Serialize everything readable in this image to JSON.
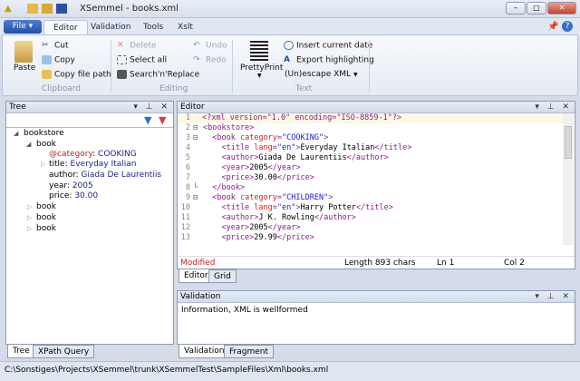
{
  "window": {
    "title": "XSemmel - books.xml",
    "min": "–",
    "max": "□",
    "close": "✕"
  },
  "ribbon": {
    "file": "File ▾",
    "tabs": [
      "Editor",
      "Validation",
      "Tools",
      "Xslt"
    ],
    "clipboard": {
      "paste": "Paste",
      "cut": "Cut",
      "copy": "Copy",
      "copy_path": "Copy file path",
      "group": "Clipboard"
    },
    "editing": {
      "delete": "Delete",
      "select_all": "Select all",
      "search": "Search'n'Replace",
      "undo": "Undo",
      "redo": "Redo",
      "group": "Editing"
    },
    "text": {
      "pretty": "PrettyPrint",
      "insert_date": "Insert current date",
      "export": "Export highlighting",
      "unescape": "(Un)escape XML",
      "group": "Text"
    }
  },
  "tree": {
    "title": "Tree",
    "controls": "▾ ⊥ ✕",
    "root": "bookstore",
    "book": "book",
    "cat_key": "@category",
    "cat_val": "COOKING",
    "title_key": "title:",
    "title_val": "Everyday Italian",
    "author_key": "author:",
    "author_val": "Giada De Laurentiis",
    "year_key": "year:",
    "year_val": "2005",
    "price_key": "price:",
    "price_val": "30.00",
    "tabs": [
      "Tree",
      "XPath Query"
    ]
  },
  "editor": {
    "title": "Editor",
    "controls": "▾ ⊥ ✕",
    "lines": [
      [
        [
          "t",
          "<?xml version=\"1.0\" encoding=\"ISO-8859-1\"?>"
        ]
      ],
      [
        [
          "t",
          "<bookstore>"
        ]
      ],
      [
        [
          "t",
          "  <book "
        ],
        [
          "a",
          "category"
        ],
        [
          "t",
          "="
        ],
        [
          "v",
          "\"COOKING\""
        ],
        [
          "t",
          ">"
        ]
      ],
      [
        [
          "t",
          "    <title "
        ],
        [
          "a",
          "lang"
        ],
        [
          "t",
          "="
        ],
        [
          "v",
          "\"en\""
        ],
        [
          "t",
          ">"
        ],
        [
          "x",
          "Everyday Italian"
        ],
        [
          "t",
          "</title>"
        ]
      ],
      [
        [
          "t",
          "    <author>"
        ],
        [
          "x",
          "Giada De Laurentiis"
        ],
        [
          "t",
          "</author>"
        ]
      ],
      [
        [
          "t",
          "    <year>"
        ],
        [
          "x",
          "2005"
        ],
        [
          "t",
          "</year>"
        ]
      ],
      [
        [
          "t",
          "    <price>"
        ],
        [
          "x",
          "30.00"
        ],
        [
          "t",
          "</price>"
        ]
      ],
      [
        [
          "t",
          "  </book>"
        ]
      ],
      [
        [
          "t",
          "  <book "
        ],
        [
          "a",
          "category"
        ],
        [
          "t",
          "="
        ],
        [
          "v",
          "\"CHILDREN\""
        ],
        [
          "t",
          ">"
        ]
      ],
      [
        [
          "t",
          "    <title "
        ],
        [
          "a",
          "lang"
        ],
        [
          "t",
          "="
        ],
        [
          "v",
          "\"en\""
        ],
        [
          "t",
          ">"
        ],
        [
          "x",
          "Harry Potter"
        ],
        [
          "t",
          "</title>"
        ]
      ],
      [
        [
          "t",
          "    <author>"
        ],
        [
          "x",
          "J K. Rowling"
        ],
        [
          "t",
          "</author>"
        ]
      ],
      [
        [
          "t",
          "    <year>"
        ],
        [
          "x",
          "2005"
        ],
        [
          "t",
          "</year>"
        ]
      ],
      [
        [
          "t",
          "    <price>"
        ],
        [
          "x",
          "29.99"
        ],
        [
          "t",
          "</price>"
        ]
      ]
    ],
    "status": {
      "modified": "Modified",
      "length": "Length 893 chars",
      "ln": "Ln 1",
      "col": "Col 2"
    },
    "tabs": [
      "Editor",
      "Grid"
    ]
  },
  "validation": {
    "title": "Validation",
    "controls": "▾ ⊥ ✕",
    "message": "Information, XML is wellformed",
    "tabs": [
      "Validation",
      "Fragment"
    ]
  },
  "statusbar": {
    "path": "C:\\Sonstiges\\Projects\\XSemmel\\trunk\\XSemmelTest\\SampleFiles\\Xml\\books.xml"
  }
}
